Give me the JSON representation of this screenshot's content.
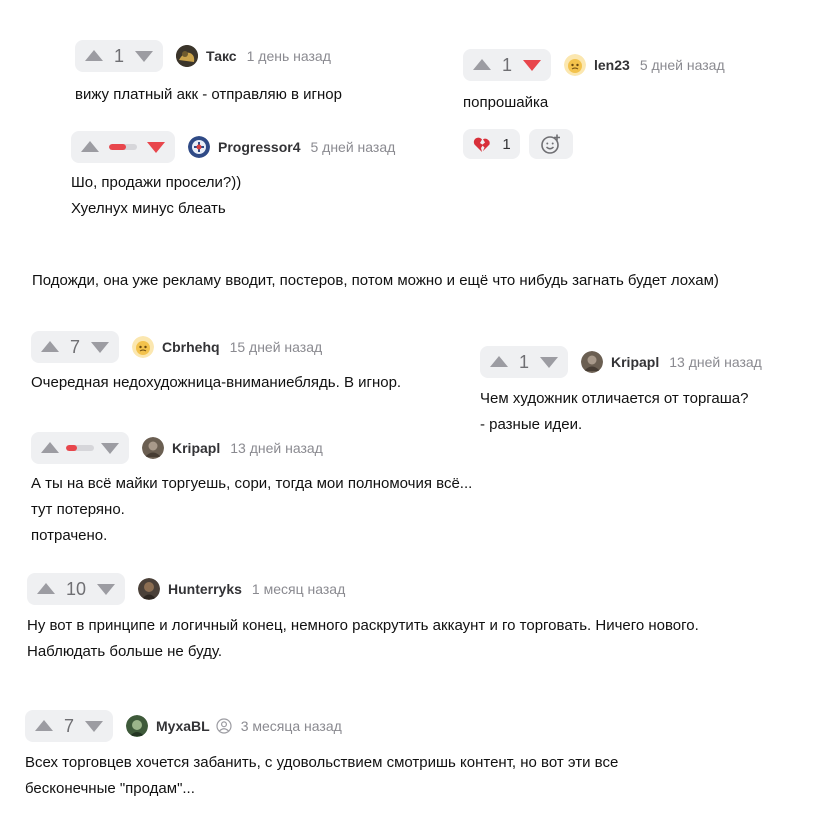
{
  "comments": {
    "takc": {
      "votes": "1",
      "author": "Такс",
      "time": "1 день назад",
      "lines": [
        "вижу платный акк - отправляю в игнор"
      ]
    },
    "len23": {
      "votes": "1",
      "author": "len23",
      "time": "5 дней назад",
      "lines": [
        "попрошайка"
      ],
      "reaction_count": "1"
    },
    "progressor4": {
      "rating_ratio": 0.6,
      "author": "Progressor4",
      "time": "5 дней назад",
      "lines": [
        "Шо, продажи просели?))",
        "Хуелнух минус блеать"
      ]
    },
    "standalone": {
      "lines": [
        "Подожди, она уже рекламу вводит, постеров, потом можно и ещё что нибудь загнать будет лохам)"
      ]
    },
    "cbrhehq": {
      "votes": "7",
      "author": "Cbrhehq",
      "time": "15 дней назад",
      "lines": [
        "Очередная недохудожница-вниманиеблядь. В игнор."
      ]
    },
    "kripapl_right": {
      "votes": "1",
      "author": "Kripapl",
      "time": "13 дней назад",
      "lines": [
        "Чем художник отличается от торгаша?",
        "- разные идеи."
      ]
    },
    "kripapl_left": {
      "rating_ratio": 0.4,
      "author": "Kripapl",
      "time": "13 дней назад",
      "lines": [
        "А ты на всё майки торгуешь, сори, тогда мои полномочия всё...",
        "тут потеряно.",
        "потрачено."
      ]
    },
    "hunterryks": {
      "votes": "10",
      "author": "Hunterryks",
      "time": "1 месяц назад",
      "lines": [
        "Ну вот в принципе и логичный конец, немного раскрутить аккаунт и го торговать. Ничего нового.",
        "Наблюдать больше не буду."
      ]
    },
    "muxabl": {
      "votes": "7",
      "author": "MyxaBL",
      "time": "3 месяца назад",
      "lines": [
        "Всех торговцев хочется забанить, с удовольствием смотришь контент, но вот эти все",
        "бесконечные \"продам\"..."
      ]
    }
  },
  "icons": {
    "upvote": "triangle-up-icon",
    "downvote": "triangle-down-icon",
    "broken_heart": "broken-heart-icon",
    "add_reaction": "smiley-plus-icon",
    "profile": "user-circle-icon"
  },
  "colors": {
    "arrow_gray": "#9c9ca2",
    "downvote_active": "#e8464c",
    "pill_bg": "#eff0f2",
    "author_text": "#333336",
    "time_text": "#8a8a90"
  }
}
